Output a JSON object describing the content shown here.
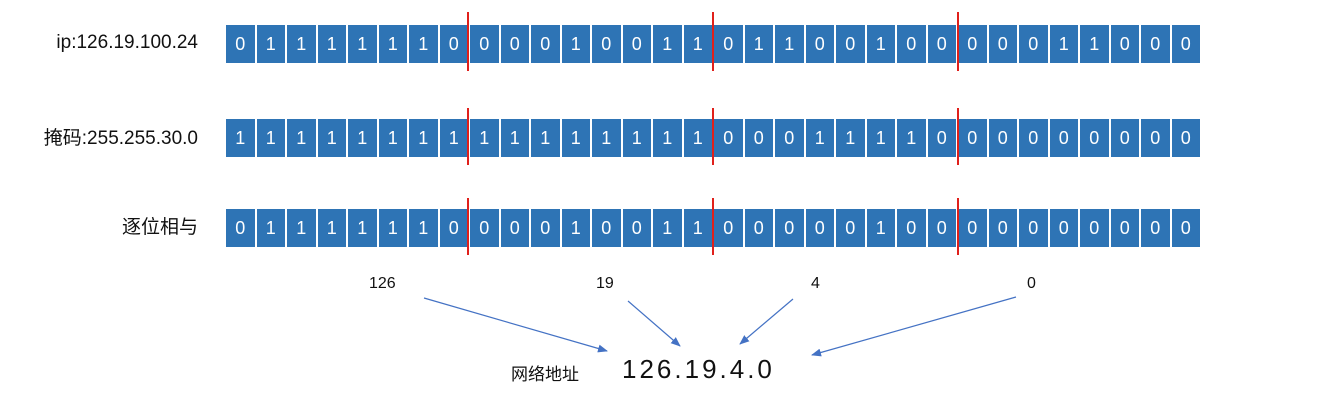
{
  "rows": [
    {
      "label": "ip:126.19.100.24",
      "bits": [
        "0",
        "1",
        "1",
        "1",
        "1",
        "1",
        "1",
        "0",
        "0",
        "0",
        "0",
        "1",
        "0",
        "0",
        "1",
        "1",
        "0",
        "1",
        "1",
        "0",
        "0",
        "1",
        "0",
        "0",
        "0",
        "0",
        "0",
        "1",
        "1",
        "0",
        "0",
        "0"
      ]
    },
    {
      "label": "掩码:255.255.30.0",
      "bits": [
        "1",
        "1",
        "1",
        "1",
        "1",
        "1",
        "1",
        "1",
        "1",
        "1",
        "1",
        "1",
        "1",
        "1",
        "1",
        "1",
        "0",
        "0",
        "0",
        "1",
        "1",
        "1",
        "1",
        "0",
        "0",
        "0",
        "0",
        "0",
        "0",
        "0",
        "0",
        "0"
      ]
    },
    {
      "label": "逐位相与",
      "bits": [
        "0",
        "1",
        "1",
        "1",
        "1",
        "1",
        "1",
        "0",
        "0",
        "0",
        "0",
        "1",
        "0",
        "0",
        "1",
        "1",
        "0",
        "0",
        "0",
        "0",
        "0",
        "1",
        "0",
        "0",
        "0",
        "0",
        "0",
        "0",
        "0",
        "0",
        "0",
        "0"
      ]
    }
  ],
  "octets": [
    "126",
    "19",
    "4",
    "0"
  ],
  "result": {
    "label": "网络地址",
    "value": "126.19.4.0"
  },
  "colors": {
    "bit_fill": "#2e74b5",
    "bit_text": "#ffffff",
    "separator": "#e0201b",
    "arrow": "#4472c4"
  }
}
